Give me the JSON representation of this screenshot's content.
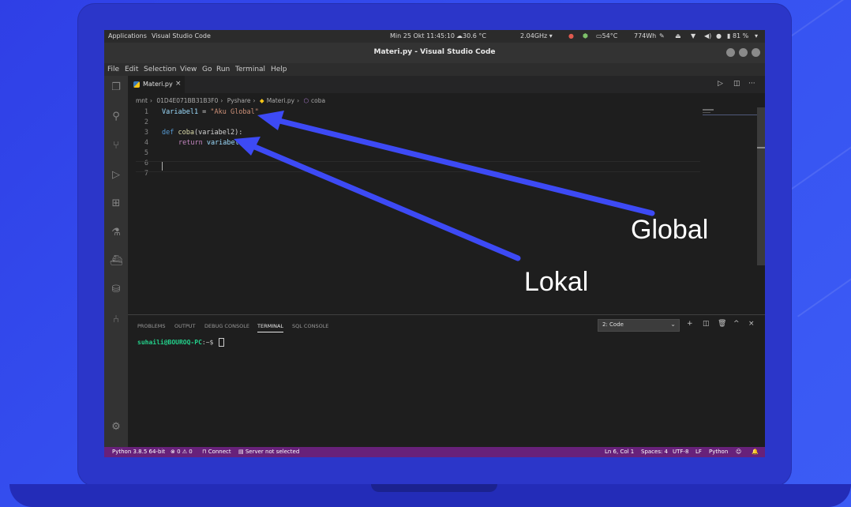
{
  "system_bar": {
    "applications": "Applications",
    "app_name": "Visual Studio Code",
    "datetime": "Min 25 Okt  11:45:10",
    "weather": "30.6 °C",
    "cpu": "2.04GHz",
    "temp": "54°C",
    "power": "774Wh",
    "battery": "81 %"
  },
  "window": {
    "title": "Materi.py - Visual Studio Code"
  },
  "menu": [
    "File",
    "Edit",
    "Selection",
    "View",
    "Go",
    "Run",
    "Terminal",
    "Help"
  ],
  "activity_icons": [
    "explorer-icon",
    "search-icon",
    "source-control-icon",
    "run-debug-icon",
    "extensions-icon",
    "testing-icon",
    "docker-icon",
    "database-icon",
    "git-graph-icon",
    "settings-gear-icon"
  ],
  "tab": {
    "label": "Materi.py",
    "close": "×"
  },
  "breadcrumb": [
    "mnt",
    "01D4E071BB31B3F0",
    "Pyshare",
    "Materi.py",
    "coba"
  ],
  "code_lines": [
    {
      "n": "1"
    },
    {
      "n": "2"
    },
    {
      "n": "3"
    },
    {
      "n": "4"
    },
    {
      "n": "5"
    },
    {
      "n": "6"
    },
    {
      "n": "7"
    }
  ],
  "code": {
    "l1_var": "Variabel1",
    "l1_eq": " = ",
    "l1_str": "\"Aku Global\"",
    "l3_def": "def ",
    "l3_fn": "coba",
    "l3_args": "(variabel2):",
    "l4_ret": "return ",
    "l4_var": "variabel"
  },
  "panel": {
    "tabs": [
      "PROBLEMS",
      "OUTPUT",
      "DEBUG CONSOLE",
      "TERMINAL",
      "SQL CONSOLE"
    ],
    "terminal_select": "2: Code",
    "prompt_user": "suhaili@BOUROQ-PC",
    "prompt_rest": ":~$ "
  },
  "status": {
    "python": "Python 3.8.5 64-bit",
    "problems": "⊗ 0 ⚠ 0",
    "connect": "Connect",
    "server": "Server not selected",
    "position": "Ln 6, Col 1",
    "spaces": "Spaces: 4",
    "encoding": "UTF-8",
    "eol": "LF",
    "language": "Python"
  },
  "annotations": {
    "global": "Global",
    "lokal": "Lokal"
  },
  "colors": {
    "arrow": "#3d4af5",
    "statusbar": "#68217a",
    "background": "#3550f0"
  }
}
